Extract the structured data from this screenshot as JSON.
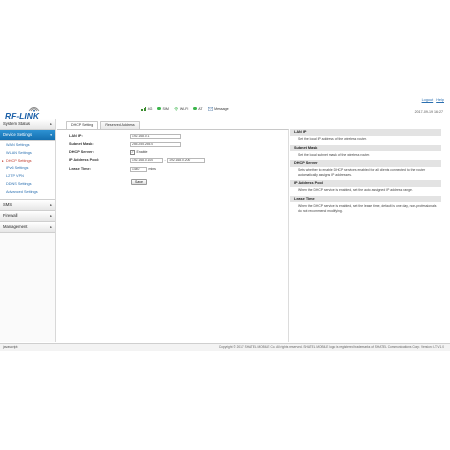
{
  "header": {
    "logo_text": "RF-LINK",
    "status": [
      {
        "icon": "signal-bars-icon",
        "label": "4G"
      },
      {
        "icon": "sim-icon",
        "label": "SIM",
        "color": "#3ab54a"
      },
      {
        "icon": "wifi-icon",
        "label": "Wi-Fi",
        "color": "#3ab54a"
      },
      {
        "icon": "sim-icon",
        "label": "AT",
        "color": "#3ab54a"
      },
      {
        "icon": "message-icon",
        "label": "Message"
      }
    ],
    "logout": "Logout",
    "help": "Help",
    "datetime": "2017-09-19 16:27"
  },
  "sidebar": {
    "sections": [
      {
        "label": "System Status",
        "arrow": "▸"
      },
      {
        "label": "Device Settings",
        "arrow": "▾",
        "active": true
      },
      {
        "label": "SMS",
        "arrow": "▸"
      },
      {
        "label": "Firewall",
        "arrow": "▸"
      },
      {
        "label": "Management",
        "arrow": "▸"
      }
    ],
    "device_items": [
      "WAN Settings",
      "WLAN Settings",
      "DHCP Settings",
      "IPv6 Settings",
      "L2TP VPN",
      "DDNS Settings",
      "Advanced Settings"
    ],
    "selected_item": "DHCP Settings"
  },
  "tabs": [
    "DHCP Setting",
    "Reserved Address"
  ],
  "form": {
    "lan_ip_label": "LAN IP:",
    "lan_ip_value": "192.168.0.1",
    "subnet_label": "Subnet Mask:",
    "subnet_value": "255.255.255.0",
    "dhcp_label": "DHCP Server:",
    "dhcp_enable": "Enable",
    "pool_label": "IP Address Pool:",
    "pool_start": "192.168.0.100",
    "pool_sep": "-",
    "pool_end": "192.168.0.200",
    "lease_label": "Lease Time:",
    "lease_value": "1440",
    "lease_unit": "mins",
    "save_label": "Save"
  },
  "help": [
    {
      "title": "LAN IP",
      "text": "Set the local IP address of the wireless router."
    },
    {
      "title": "Subnet Mask",
      "text": "Set the local subnet mask of the wireless router."
    },
    {
      "title": "DHCP Server",
      "text": "Sets whether to enable DHCP services enabled for all clients connected to the router automatically assigns IP addresses."
    },
    {
      "title": "IP Address Pool",
      "text": "When the DHCP service is enabled, set the auto assigned IP address range."
    },
    {
      "title": "Lease Time",
      "text": "When the DHCP service is enabled, set the lease time, default is one day, non-professionals do not recommend modifying."
    }
  ],
  "footer": {
    "left": "javascript:",
    "copyright": "Copyright © 2017 SHATEL MOBILE Co. All rights reserved. SHATEL MOBILE logo is registered trademarks of SHATEL Communications Corp. Version: LT.V1.0"
  }
}
